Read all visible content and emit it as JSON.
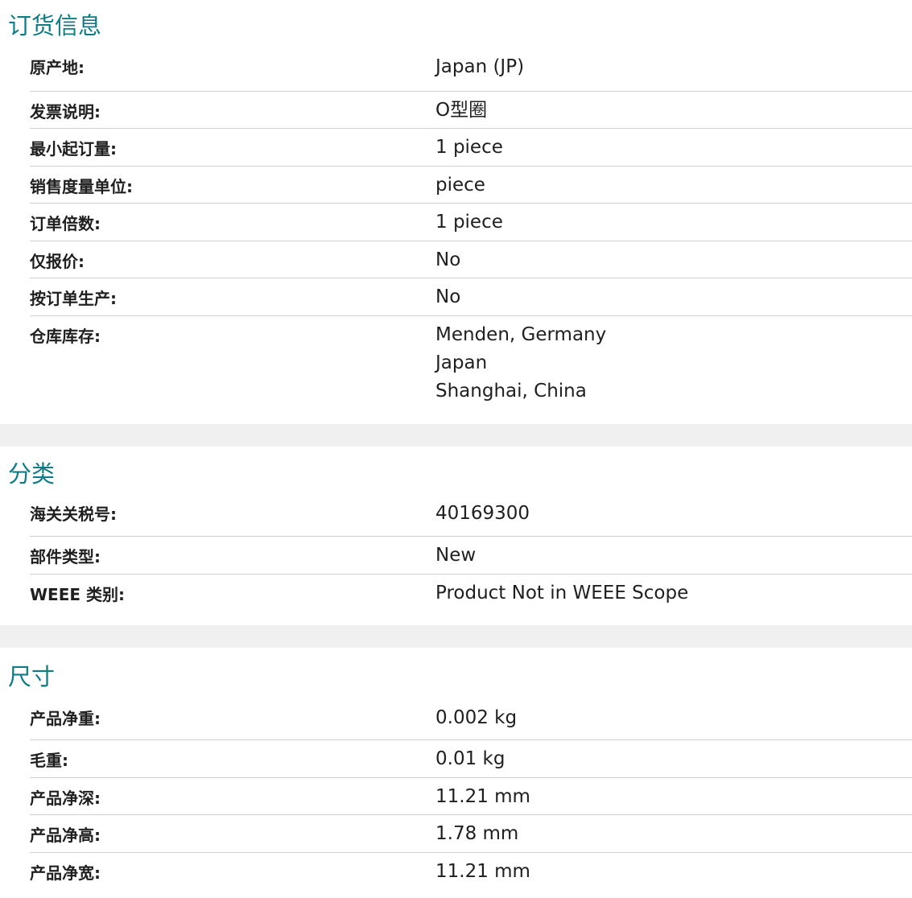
{
  "sections": [
    {
      "title": "订货信息",
      "rows": [
        {
          "label": "原产地:",
          "value": "Japan (JP)"
        },
        {
          "label": "发票说明:",
          "value": "O型圈"
        },
        {
          "label": "最小起订量:",
          "value": "1 piece"
        },
        {
          "label": "销售度量单位:",
          "value": "piece"
        },
        {
          "label": "订单倍数:",
          "value": "1 piece"
        },
        {
          "label": "仅报价:",
          "value": "No"
        },
        {
          "label": "按订单生产:",
          "value": "No"
        },
        {
          "label": "仓库库存:",
          "values": [
            "Menden, Germany",
            "Japan",
            "Shanghai, China"
          ]
        }
      ]
    },
    {
      "title": "分类",
      "rows": [
        {
          "label": "海关关税号:",
          "value": "40169300"
        },
        {
          "label": "部件类型:",
          "value": "New"
        },
        {
          "label": "WEEE 类别:",
          "value": "Product Not in WEEE Scope"
        }
      ]
    },
    {
      "title": "尺寸",
      "rows": [
        {
          "label": "产品净重:",
          "value": "0.002 kg"
        },
        {
          "label": "毛重:",
          "value": "0.01 kg"
        },
        {
          "label": "产品净深:",
          "value": "11.21 mm"
        },
        {
          "label": "产品净高:",
          "value": "1.78 mm"
        },
        {
          "label": "产品净宽:",
          "value": "11.21 mm"
        }
      ]
    }
  ]
}
